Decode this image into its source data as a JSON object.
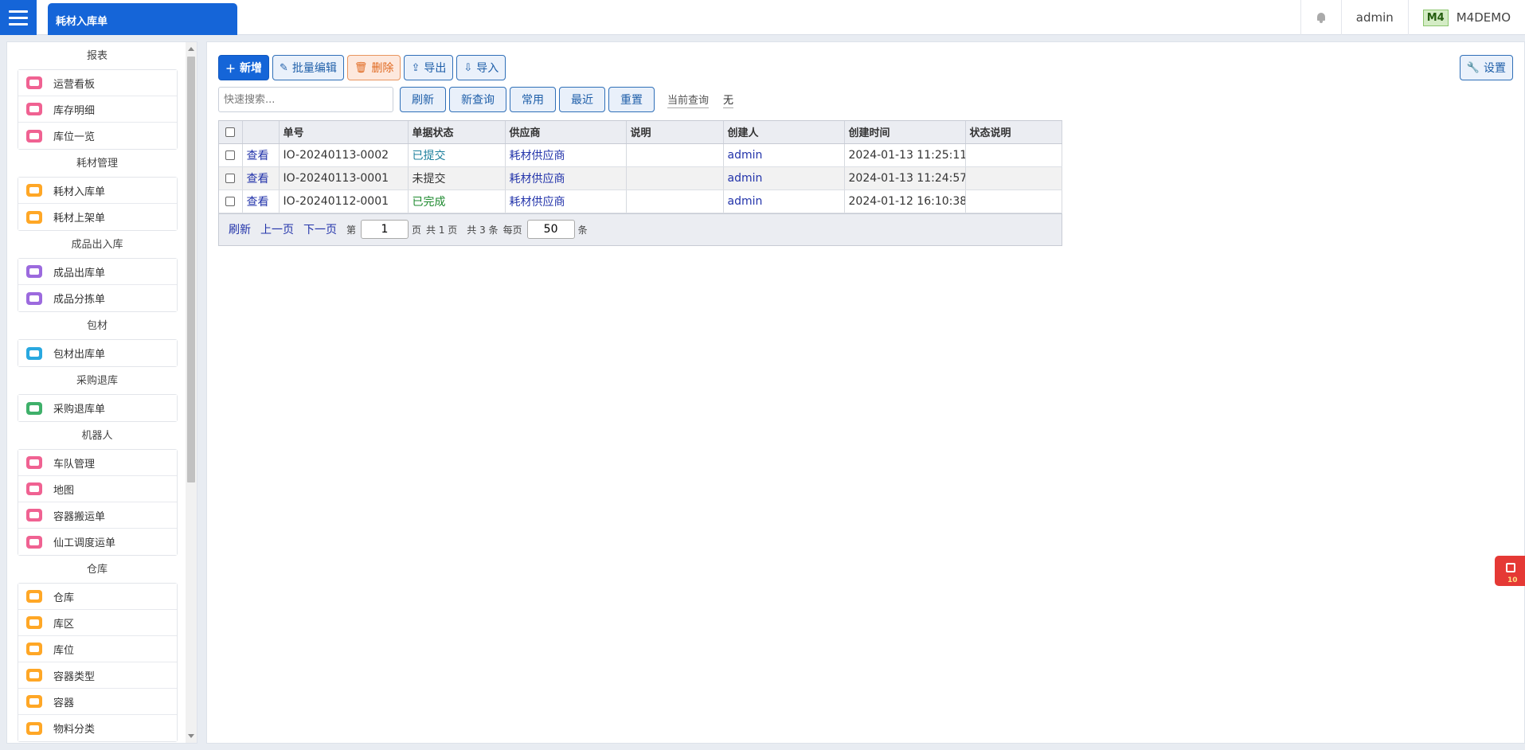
{
  "topbar": {
    "active_tab": "耗材入库单",
    "user": "admin",
    "app_badge": "M4",
    "app_name": "M4DEMO"
  },
  "sidebar": {
    "groups": [
      {
        "title": "报表",
        "items": [
          {
            "label": "运营看板",
            "color": "#f06292"
          },
          {
            "label": "库存明细",
            "color": "#f06292"
          },
          {
            "label": "库位一览",
            "color": "#f06292"
          }
        ]
      },
      {
        "title": "耗材管理",
        "items": [
          {
            "label": "耗材入库单",
            "color": "#ffa726"
          },
          {
            "label": "耗材上架单",
            "color": "#ffa726"
          }
        ]
      },
      {
        "title": "成品出入库",
        "items": [
          {
            "label": "成品出库单",
            "color": "#9c6ade"
          },
          {
            "label": "成品分拣单",
            "color": "#9c6ade"
          }
        ]
      },
      {
        "title": "包材",
        "items": [
          {
            "label": "包材出库单",
            "color": "#29a8e0"
          }
        ]
      },
      {
        "title": "采购退库",
        "items": [
          {
            "label": "采购退库单",
            "color": "#3fb06a"
          }
        ]
      },
      {
        "title": "机器人",
        "items": [
          {
            "label": "车队管理",
            "color": "#f06292"
          },
          {
            "label": "地图",
            "color": "#f06292"
          },
          {
            "label": "容器搬运单",
            "color": "#f06292"
          },
          {
            "label": "仙工调度运单",
            "color": "#f06292"
          }
        ]
      },
      {
        "title": "仓库",
        "items": [
          {
            "label": "仓库",
            "color": "#ffa726"
          },
          {
            "label": "库区",
            "color": "#ffa726"
          },
          {
            "label": "库位",
            "color": "#ffa726"
          },
          {
            "label": "容器类型",
            "color": "#ffa726"
          },
          {
            "label": "容器",
            "color": "#ffa726"
          },
          {
            "label": "物料分类",
            "color": "#ffa726"
          }
        ]
      }
    ]
  },
  "toolbar": {
    "add": "新增",
    "batch_edit": "批量编辑",
    "delete": "删除",
    "export": "导出",
    "import": "导入",
    "settings": "设置"
  },
  "search": {
    "placeholder": "快速搜索...",
    "refresh": "刷新",
    "new_query": "新查询",
    "common": "常用",
    "recent": "最近",
    "reset": "重置",
    "current_query_label": "当前查询",
    "current_query_value": "无"
  },
  "table": {
    "columns": [
      "",
      "",
      "单号",
      "单据状态",
      "供应商",
      "说明",
      "创建人",
      "创建时间",
      "状态说明"
    ],
    "view_label": "查看",
    "rows": [
      {
        "id": "IO-20240113-0002",
        "status": "已提交",
        "status_class": "st-submitted",
        "supplier": "耗材供应商",
        "note": "",
        "creator": "admin",
        "created": "2024-01-13 11:25:11",
        "status_note": ""
      },
      {
        "id": "IO-20240113-0001",
        "status": "未提交",
        "status_class": "",
        "supplier": "耗材供应商",
        "note": "",
        "creator": "admin",
        "created": "2024-01-13 11:24:57",
        "status_note": ""
      },
      {
        "id": "IO-20240112-0001",
        "status": "已完成",
        "status_class": "st-done",
        "supplier": "耗材供应商",
        "note": "",
        "creator": "admin",
        "created": "2024-01-12 16:10:38",
        "status_note": ""
      }
    ]
  },
  "pager": {
    "refresh": "刷新",
    "prev": "上一页",
    "next": "下一页",
    "page_prefix": "第",
    "page_value": "1",
    "page_suffix": "页",
    "total_pages": "共 1 页",
    "total_rows": "共 3 条",
    "per_page_label": "每页",
    "per_page_value": "50",
    "per_page_suffix": "条"
  },
  "notification": {
    "count": "10"
  }
}
